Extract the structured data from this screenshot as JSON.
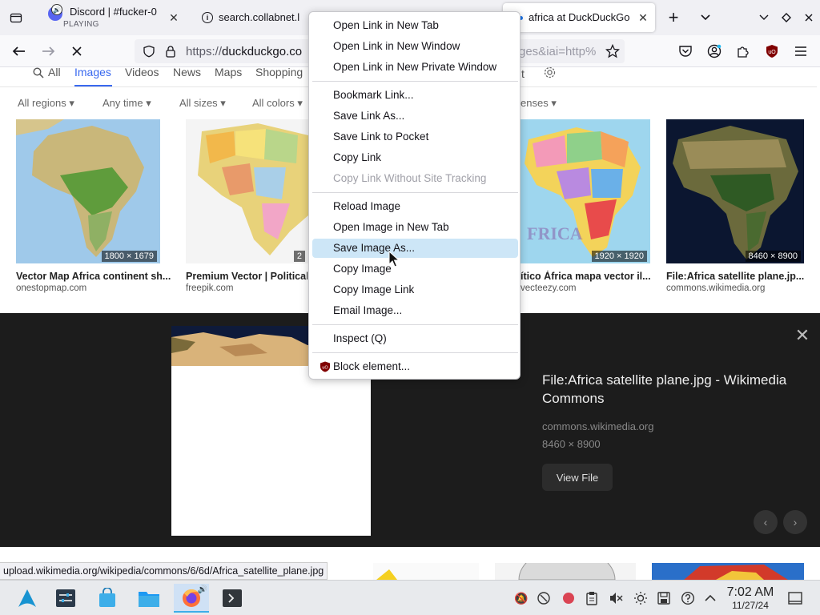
{
  "tabs": {
    "discord": {
      "title": "Discord | #fucker-0",
      "subtitle": "PLAYING"
    },
    "collabnet": {
      "title": "search.collabnet.l"
    },
    "active": {
      "title": "africa at DuckDuckGo"
    }
  },
  "navbar": {
    "url_prefix": "https://",
    "url_host": "duckduckgo.co",
    "url_tail": "ges&iai=http%"
  },
  "ddg": {
    "tabs": [
      "All",
      "Images",
      "Videos",
      "News",
      "Maps",
      "Shopping"
    ],
    "filters": [
      "All regions",
      "Any time",
      "All sizes",
      "All colors",
      "enses"
    ]
  },
  "results": [
    {
      "title": "Vector Map Africa continent sh...",
      "source": "onestopmap.com",
      "dims": "1800 × 1679"
    },
    {
      "title": "Premium Vector | Political",
      "source": "freepik.com",
      "dims": "2"
    },
    {
      "title": "ítico África mapa vector il...",
      "source": "vecteezy.com",
      "dims": "1920 × 1920"
    },
    {
      "title": "File:Africa satellite plane.jp...",
      "source": "commons.wikimedia.org",
      "dims": "8460 × 8900"
    }
  ],
  "detail": {
    "title": "File:Africa satellite plane.jpg - Wikimedia Commons",
    "site": "commons.wikimedia.org",
    "dims": "8460 × 8900",
    "view_button": "View File"
  },
  "context_menu": {
    "items": [
      {
        "label": "Open Link in New Tab",
        "disabled": false
      },
      {
        "label": "Open Link in New Window",
        "disabled": false
      },
      {
        "label": "Open Link in New Private Window",
        "disabled": false
      },
      {
        "label": "Bookmark Link...",
        "disabled": false
      },
      {
        "label": "Save Link As...",
        "disabled": false
      },
      {
        "label": "Save Link to Pocket",
        "disabled": false
      },
      {
        "label": "Copy Link",
        "disabled": false
      },
      {
        "label": "Copy Link Without Site Tracking",
        "disabled": true
      },
      {
        "label": "Reload Image",
        "disabled": false
      },
      {
        "label": "Open Image in New Tab",
        "disabled": false
      },
      {
        "label": "Save Image As...",
        "disabled": false,
        "hover": true
      },
      {
        "label": "Copy Image",
        "disabled": false
      },
      {
        "label": "Copy Image Link",
        "disabled": false
      },
      {
        "label": "Email Image...",
        "disabled": false
      },
      {
        "label": "Inspect (Q)",
        "disabled": false
      },
      {
        "label": "Block element...",
        "disabled": false
      }
    ]
  },
  "status_url": "upload.wikimedia.org/wikipedia/commons/6/6d/Africa_satellite_plane.jpg",
  "clock": {
    "time": "7:02 AM",
    "date": "11/27/24"
  },
  "colors": {
    "accent": "#3969ef",
    "menu_hover": "#cde6f7",
    "detail_bg": "#1c1c1c"
  }
}
